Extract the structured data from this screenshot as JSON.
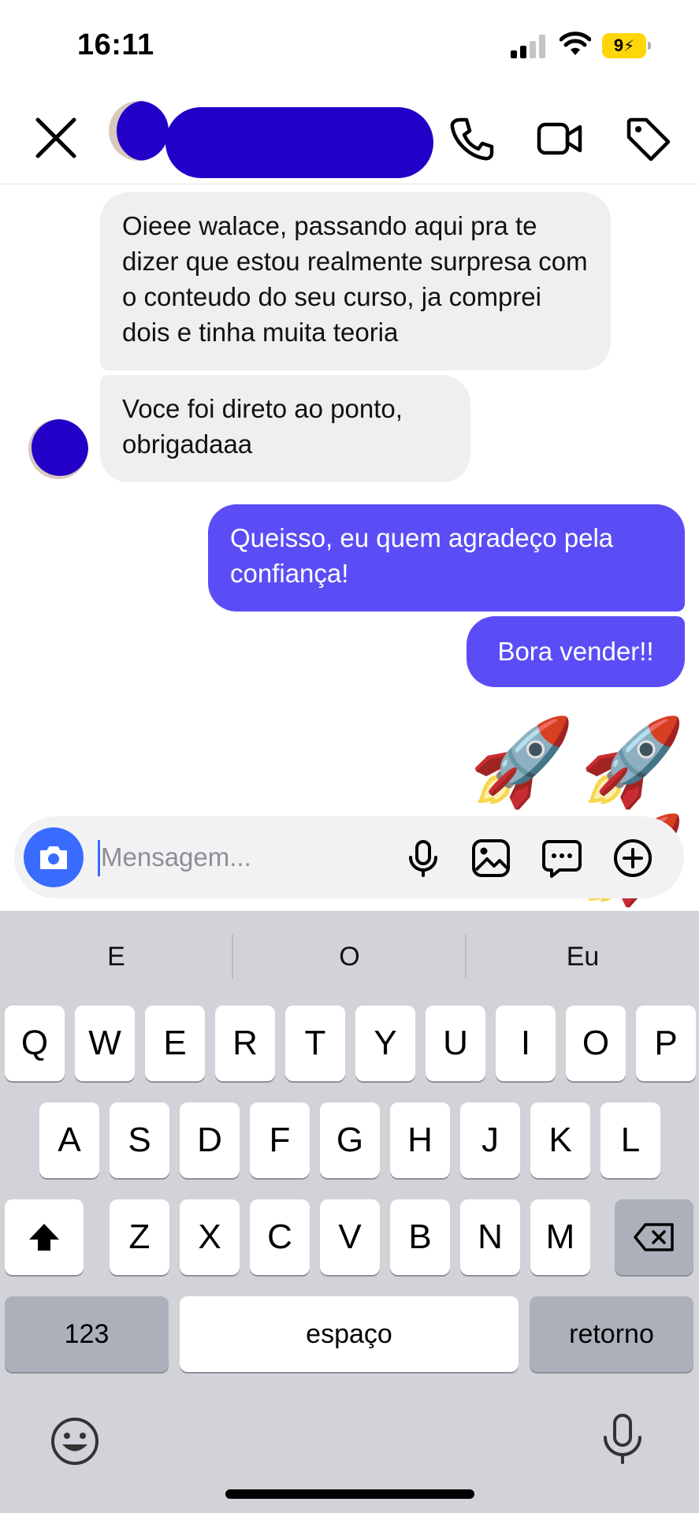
{
  "status_bar": {
    "time": "16:11",
    "battery": "9"
  },
  "header": {
    "close_label": "close",
    "actions": [
      "call",
      "video-call",
      "tag"
    ]
  },
  "messages": [
    {
      "direction": "in",
      "text": "Oieee walace, passando aqui pra te dizer que estou realmente surpresa com o conteudo do seu curso, ja comprei dois e tinha muita teoria"
    },
    {
      "direction": "in",
      "text": "Voce foi direto ao ponto, obrigadaaa"
    },
    {
      "direction": "out",
      "text": "Queisso, eu quem agradeço pela confiança!"
    },
    {
      "direction": "out",
      "text": "Bora vender!!"
    },
    {
      "direction": "out",
      "text": "🚀🚀🚀"
    }
  ],
  "composer": {
    "placeholder": "Mensagem..."
  },
  "keyboard": {
    "suggestions": [
      "E",
      "O",
      "Eu"
    ],
    "row1": [
      "Q",
      "W",
      "E",
      "R",
      "T",
      "Y",
      "U",
      "I",
      "O",
      "P"
    ],
    "row2": [
      "A",
      "S",
      "D",
      "F",
      "G",
      "H",
      "J",
      "K",
      "L"
    ],
    "row3": [
      "Z",
      "X",
      "C",
      "V",
      "B",
      "N",
      "M"
    ],
    "numbers_key": "123",
    "space_key": "espaço",
    "return_key": "retorno"
  },
  "colors": {
    "outgoing_bubble": "#5b4df5",
    "incoming_bubble": "#efefef",
    "accent": "#3a6bff",
    "redaction": "#2200c8"
  }
}
